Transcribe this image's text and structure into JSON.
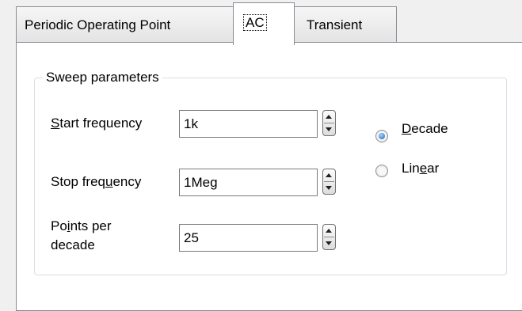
{
  "tabs": [
    {
      "label": "Periodic Operating Point",
      "selected": false
    },
    {
      "label": "AC",
      "selected": true
    },
    {
      "label": "Transient",
      "selected": false
    }
  ],
  "group": {
    "title": "Sweep parameters"
  },
  "fields": {
    "start": {
      "label_pre": "",
      "label_mnemonic": "S",
      "label_post": "tart frequency",
      "value": "1k"
    },
    "stop": {
      "label_pre": "Stop freq",
      "label_mnemonic": "u",
      "label_post": "ency",
      "value": "1Meg"
    },
    "points": {
      "label_line1_pre": "Po",
      "label_mnemonic": "i",
      "label_line1_post": "nts per",
      "label_line2": "decade",
      "value": "25"
    }
  },
  "scale": {
    "decade": {
      "pre": "",
      "mnemonic": "D",
      "post": "ecade",
      "checked": true
    },
    "linear": {
      "pre": "Lin",
      "mnemonic": "e",
      "post": "ar",
      "checked": false
    }
  }
}
